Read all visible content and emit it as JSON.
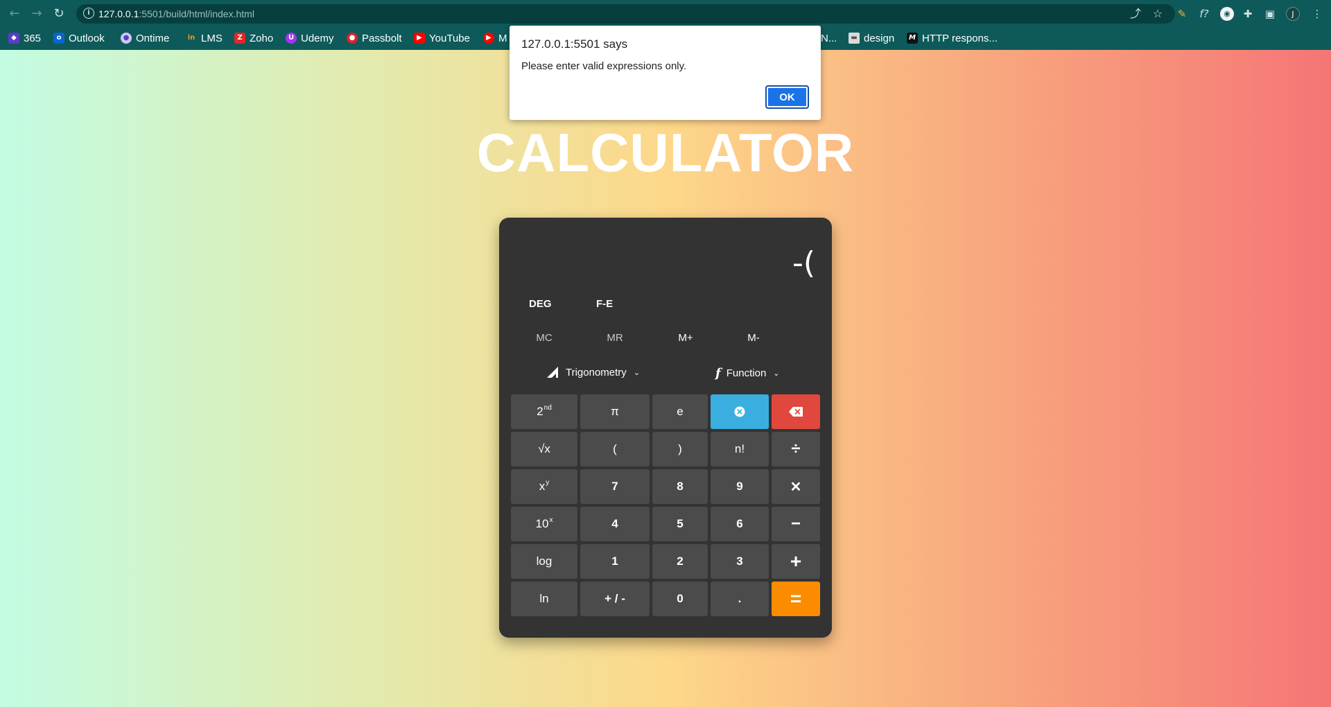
{
  "browser": {
    "url_host": "127.0.0.1",
    "url_rest": ":5501/build/html/index.html",
    "profile_initial": "J",
    "bookmarks": [
      {
        "label": "365",
        "icon": "office365-icon",
        "color": "#5b3cc4"
      },
      {
        "label": "Outlook",
        "icon": "outlook-icon",
        "color": "#0a64d1"
      },
      {
        "label": "Ontime",
        "icon": "ontime-icon",
        "color": "#c9c9f5"
      },
      {
        "label": "LMS",
        "icon": "lms-icon",
        "color": "#f29b1c"
      },
      {
        "label": "Zoho",
        "icon": "zoho-icon",
        "color": "#e42527"
      },
      {
        "label": "Udemy",
        "icon": "udemy-icon",
        "color": "#a435f0"
      },
      {
        "label": "Passbolt",
        "icon": "passbolt-icon",
        "color": "#d3262b"
      },
      {
        "label": "YouTube",
        "icon": "youtube-icon",
        "color": "#ff0000"
      },
      {
        "label": "M",
        "icon": "youtube-music-icon",
        "color": "#ff0000"
      },
      {
        "label": "N...",
        "icon": "",
        "color": ""
      },
      {
        "label": "design",
        "icon": "folder-icon",
        "color": "#dadada"
      },
      {
        "label": "HTTP respons...",
        "icon": "mdn-icon",
        "color": "#111111"
      }
    ]
  },
  "dialog": {
    "title": "127.0.0.1:5501 says",
    "message": "Please enter valid expressions only.",
    "ok_label": "OK"
  },
  "page": {
    "title": "CALCULATOR"
  },
  "calculator": {
    "display": "-(",
    "modes": [
      "DEG",
      "F-E"
    ],
    "memory": [
      "MC",
      "MR",
      "M+",
      "M-"
    ],
    "dropdowns": {
      "trigonometry": "Trigonometry",
      "function": "Function"
    },
    "keys": {
      "second": "2",
      "second_sup": "nd",
      "pi": "π",
      "e": "e",
      "sqrt": "√x",
      "lparen": "(",
      "rparen": ")",
      "fact": "n!",
      "divide": "÷",
      "power": "x",
      "power_sup": "y",
      "seven": "7",
      "eight": "8",
      "nine": "9",
      "multiply": "✕",
      "ten_pow": "10",
      "ten_pow_sup": "x",
      "four": "4",
      "five": "5",
      "six": "6",
      "minus": "−",
      "log": "log",
      "one": "1",
      "two": "2",
      "three": "3",
      "plus": "+",
      "ln": "ln",
      "negate": "+ / -",
      "zero": "0",
      "dot": ".",
      "equals": "="
    },
    "colors": {
      "body": "#333333",
      "key": "#4b4b4b",
      "clear": "#3aaedf",
      "backspace": "#e0483d",
      "equals": "#fb8c00"
    }
  }
}
